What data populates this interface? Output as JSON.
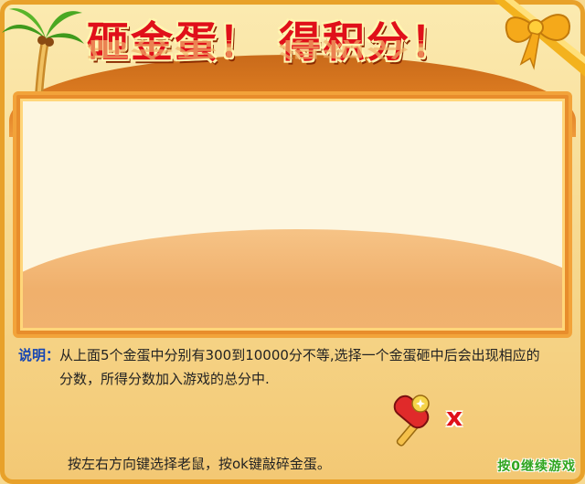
{
  "header": {
    "title": "砸金蛋！ 得积分！"
  },
  "description": {
    "label": "说明：",
    "text": "从上面5个金蛋中分别有300到10000分不等,选择一个金蛋砸中后会出现相应的分数，所得分数加入游戏的总分中."
  },
  "close": {
    "label": "x"
  },
  "instructions": "按左右方向键选择老鼠，按ok键敲碎金蛋。",
  "continue_label": "按0继续游戏",
  "colors": {
    "title_red": "#e0101a",
    "frame_orange": "#e8a12a",
    "label_blue": "#1546b3",
    "continue_green": "#2fa51e"
  },
  "icons": [
    "palm-tree-icon",
    "ribbon-bow-icon",
    "hammer-icon",
    "close-icon"
  ]
}
